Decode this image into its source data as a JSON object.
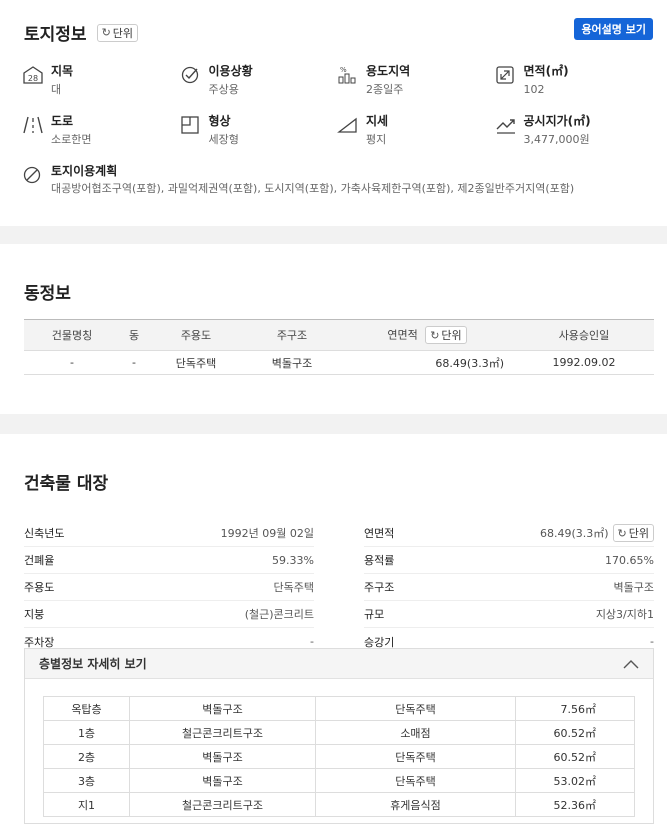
{
  "land": {
    "title": "토지정보",
    "unit_label": "단위",
    "term_button": "용어설명 보기",
    "items": [
      {
        "label": "지목",
        "value": "대",
        "icon": "land-category-icon"
      },
      {
        "label": "이용상황",
        "value": "주상용",
        "icon": "check-circle-icon"
      },
      {
        "label": "용도지역",
        "value": "2종일주",
        "icon": "zoning-chart-icon"
      },
      {
        "label": "면적(㎡)",
        "value": "102",
        "icon": "area-expand-icon"
      },
      {
        "label": "도로",
        "value": "소로한면",
        "icon": "road-icon"
      },
      {
        "label": "형상",
        "value": "세장형",
        "icon": "shape-icon"
      },
      {
        "label": "지세",
        "value": "평지",
        "icon": "terrain-icon"
      },
      {
        "label": "공시지가(㎡)",
        "value": "3,477,000원",
        "icon": "trend-up-icon"
      }
    ],
    "plan": {
      "label": "토지이용계획",
      "value": "대공방어협조구역(포함), 과밀억제권역(포함), 도시지역(포함), 가축사육제한구역(포함), 제2종일반주거지역(포함)",
      "icon": "ban-icon"
    }
  },
  "dong": {
    "title": "동정보",
    "unit_label": "단위",
    "headers": [
      "건물명칭",
      "동",
      "주용도",
      "주구조",
      "연면적",
      "사용승인일"
    ],
    "rows": [
      [
        "-",
        "-",
        "단독주택",
        "벽돌구조",
        "68.49(3.3㎡)",
        "1992.09.02"
      ]
    ]
  },
  "ledger": {
    "title": "건축물 대장",
    "unit_label": "단위",
    "pairs": [
      [
        {
          "k": "신축년도",
          "v": "1992년 09월 02일"
        },
        {
          "k": "연면적",
          "v": "68.49(3.3㎡)"
        }
      ],
      [
        {
          "k": "건폐율",
          "v": "59.33%"
        },
        {
          "k": "용적률",
          "v": "170.65%"
        }
      ],
      [
        {
          "k": "주용도",
          "v": "단독주택"
        },
        {
          "k": "주구조",
          "v": "벽돌구조"
        }
      ],
      [
        {
          "k": "지붕",
          "v": "(철근)콘크리트"
        },
        {
          "k": "규모",
          "v": "지상3/지하1"
        }
      ],
      [
        {
          "k": "주차장",
          "v": "-"
        },
        {
          "k": "승강기",
          "v": "-"
        }
      ]
    ],
    "floor_title": "층별정보 자세히 보기",
    "floors": [
      [
        "옥탑층",
        "벽돌구조",
        "단독주택",
        "7.56㎡"
      ],
      [
        "1층",
        "철근콘크리트구조",
        "소매점",
        "60.52㎡"
      ],
      [
        "2층",
        "벽돌구조",
        "단독주택",
        "60.52㎡"
      ],
      [
        "3층",
        "벽돌구조",
        "단독주택",
        "53.02㎡"
      ],
      [
        "지1",
        "철근콘크리트구조",
        "휴게음식점",
        "52.36㎡"
      ]
    ]
  }
}
